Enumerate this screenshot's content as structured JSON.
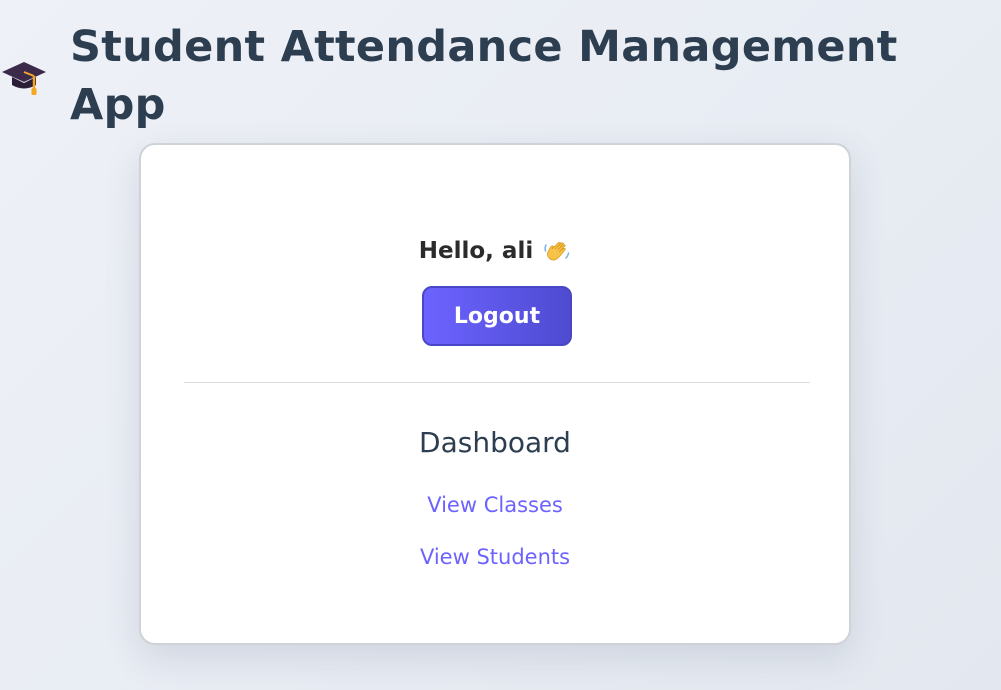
{
  "header": {
    "title": "Student Attendance Management App",
    "icon": "graduation-cap-icon"
  },
  "user": {
    "greeting": "Hello, ali",
    "greeting_icon": "waving-hand-icon"
  },
  "actions": {
    "logout_label": "Logout"
  },
  "dashboard": {
    "title": "Dashboard",
    "links": [
      {
        "label": "View Classes"
      },
      {
        "label": "View Students"
      }
    ]
  },
  "colors": {
    "accent": "#6c63ff",
    "accent_dark": "#4f4bd1",
    "heading": "#2c3e50",
    "background": "#e8ecf3",
    "card": "#ffffff"
  }
}
